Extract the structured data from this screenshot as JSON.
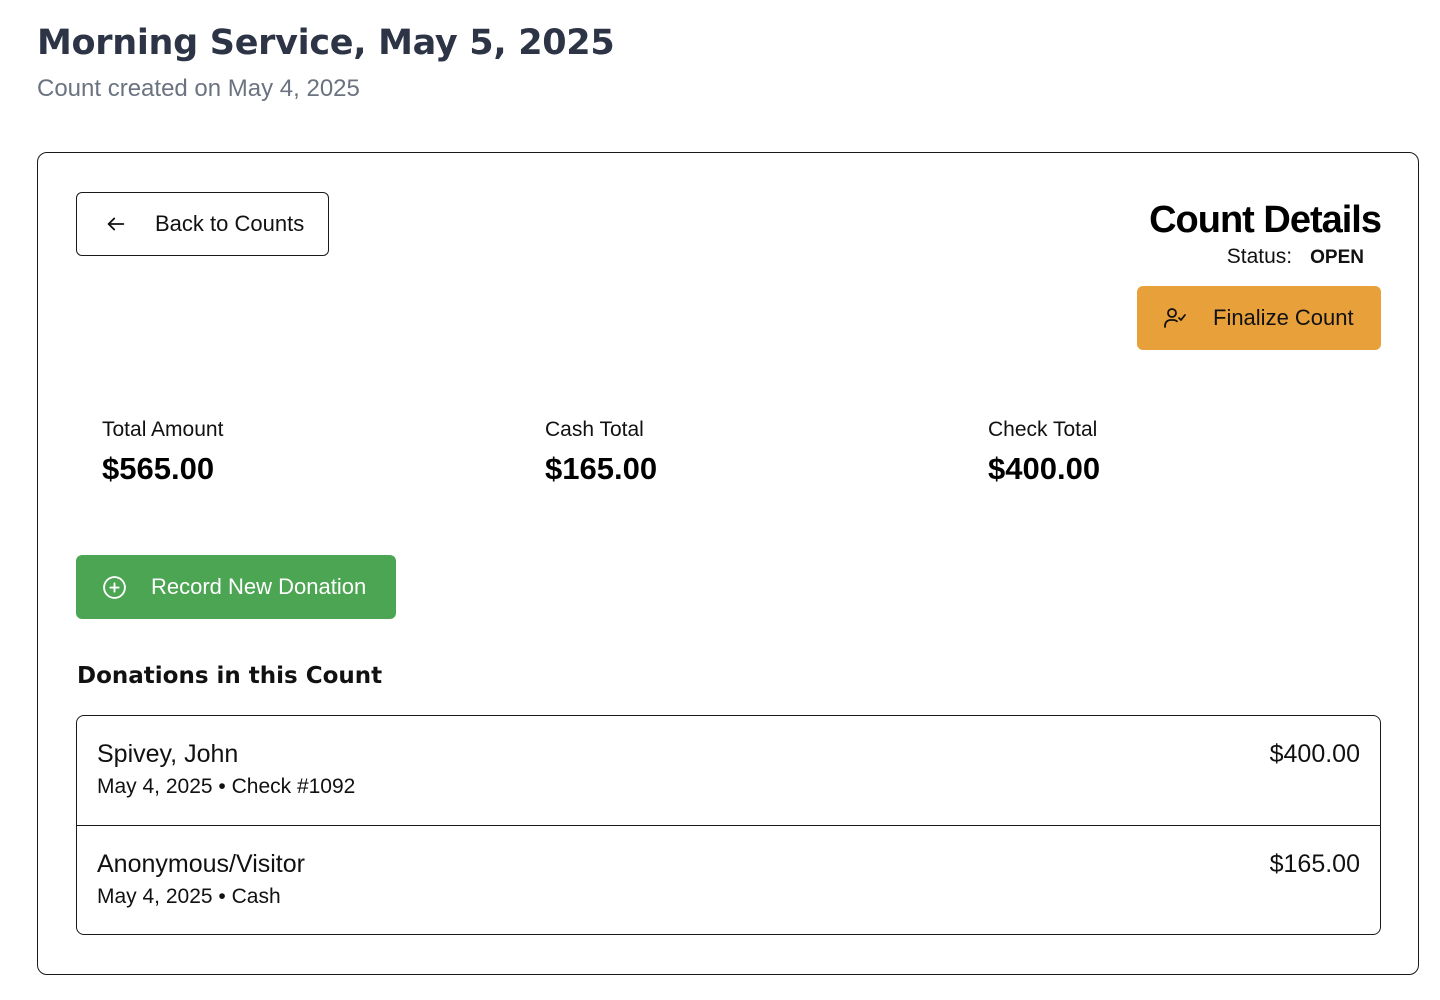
{
  "header": {
    "title": "Morning Service, May 5, 2025",
    "subtitle": "Count created on May 4, 2025"
  },
  "card": {
    "back_button_label": "Back to Counts",
    "details_title": "Count Details",
    "status_label": "Status:",
    "status_value": "OPEN",
    "finalize_button_label": "Finalize Count",
    "record_button_label": "Record New Donation",
    "section_title": "Donations in this Count"
  },
  "stats": {
    "total": {
      "label": "Total Amount",
      "value": "$565.00"
    },
    "cash": {
      "label": "Cash Total",
      "value": "$165.00"
    },
    "check": {
      "label": "Check Total",
      "value": "$400.00"
    }
  },
  "donations": [
    {
      "name": "Spivey, John",
      "meta": "May 4, 2025 • Check #1092",
      "amount": "$400.00"
    },
    {
      "name": "Anonymous/Visitor",
      "meta": "May 4, 2025 • Cash",
      "amount": "$165.00"
    }
  ],
  "colors": {
    "finalize_button": "#e8a13a",
    "record_button": "#4ca553",
    "title_text": "#2d3445",
    "subtitle_text": "#6b7380"
  },
  "icons": {
    "back": "arrow-left-icon",
    "finalize": "user-check-icon",
    "record": "plus-circle-icon"
  }
}
